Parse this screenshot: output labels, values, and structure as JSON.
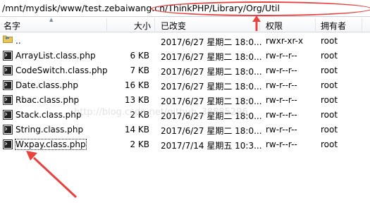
{
  "path": {
    "prefix": "/mnt/mydisk/www/test.zebaiwang.cn/",
    "highlight": "ThinkPHP/Library/Org/Util"
  },
  "columns": {
    "name": "名字",
    "size": "大小",
    "modified": "已改变",
    "permissions": "权限",
    "owner": "拥有者"
  },
  "files": [
    {
      "name": "..",
      "size": "",
      "modified": "2017/6/27 星期二 18:0...",
      "permissions": "rwxr-xr-x",
      "owner": "root",
      "icon": "parent-folder-icon"
    },
    {
      "name": "ArrayList.class.php",
      "size": "6 KB",
      "modified": "2017/6/27 星期二 18:0...",
      "permissions": "rw-r--r--",
      "owner": "root",
      "icon": "php-file-icon"
    },
    {
      "name": "CodeSwitch.class.php",
      "size": "7 KB",
      "modified": "2017/6/27 星期二 18:0...",
      "permissions": "rw-r--r--",
      "owner": "root",
      "icon": "php-file-icon"
    },
    {
      "name": "Date.class.php",
      "size": "16 KB",
      "modified": "2017/6/27 星期二 18:0...",
      "permissions": "rw-r--r--",
      "owner": "root",
      "icon": "php-file-icon"
    },
    {
      "name": "Rbac.class.php",
      "size": "13 KB",
      "modified": "2017/6/27 星期二 18:0...",
      "permissions": "rw-r--r--",
      "owner": "root",
      "icon": "php-file-icon"
    },
    {
      "name": "Stack.class.php",
      "size": "2 KB",
      "modified": "2017/6/27 星期二 18:0...",
      "permissions": "rw-r--r--",
      "owner": "root",
      "icon": "php-file-icon"
    },
    {
      "name": "String.class.php",
      "size": "14 KB",
      "modified": "2017/6/27 星期二 18:0...",
      "permissions": "rw-r--r--",
      "owner": "root",
      "icon": "php-file-icon"
    },
    {
      "name": "Wxpay.class.php",
      "size": "2 KB",
      "modified": "2017/7/14 星期五 10:3...",
      "permissions": "rw-r--r--",
      "owner": "root",
      "icon": "php-file-icon"
    }
  ],
  "watermark": "http://blog.csdn.net/github_38885296",
  "colors": {
    "annotation": "#e8423f",
    "header_separator": "#e1e4e9"
  }
}
